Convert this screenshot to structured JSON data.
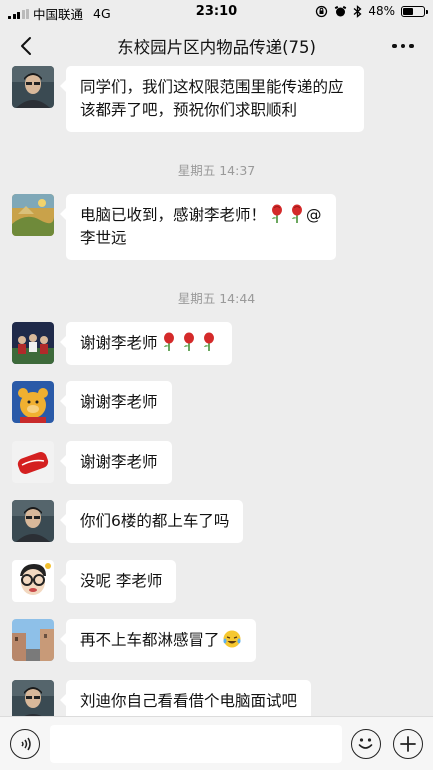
{
  "status_bar": {
    "carrier": "中国联通",
    "network": "4G",
    "time": "23:10",
    "battery_text": "48%",
    "battery_level": 0.48
  },
  "nav": {
    "title": "东校园片区内物品传递(75)",
    "back_icon": "chevron-left-icon",
    "more_icon": "more-dots-icon"
  },
  "messages": [
    {
      "text": "同学们，我们这权限范围里能传递的应该都弄了吧，预祝你们求职顺利",
      "avatar": "man-portrait"
    },
    {
      "timestamp": "星期五 14:37"
    },
    {
      "text": "电脑已收到，感谢李老师！",
      "suffix": "@李世远",
      "emojis": [
        "rose",
        "rose"
      ],
      "avatar": "painting"
    },
    {
      "timestamp": "星期五 14:44"
    },
    {
      "text": "谢谢李老师",
      "emojis": [
        "rose",
        "rose",
        "rose"
      ],
      "avatar": "sports-team"
    },
    {
      "text": "谢谢李老师",
      "avatar": "winnie-the-pooh"
    },
    {
      "text": "谢谢李老师",
      "avatar": "coca-cola-can"
    },
    {
      "text": "你们6楼的都上车了吗",
      "avatar": "man-portrait"
    },
    {
      "text": "没呢 李老师",
      "avatar": "cartoon-glasses"
    },
    {
      "text": "再不上车都淋感冒了",
      "emojis": [
        "laugh-cry"
      ],
      "avatar": "street-photo"
    },
    {
      "text": "刘迪你自己看看借个电脑面试吧",
      "avatar": "man-portrait"
    }
  ],
  "input_bar": {
    "placeholder": "",
    "voice_icon": "voice-icon",
    "emoji_icon": "emoji-icon",
    "plus_icon": "plus-icon"
  },
  "colors": {
    "background": "#ededed",
    "bubble": "#ffffff",
    "timestamp": "#9a9a9a"
  }
}
